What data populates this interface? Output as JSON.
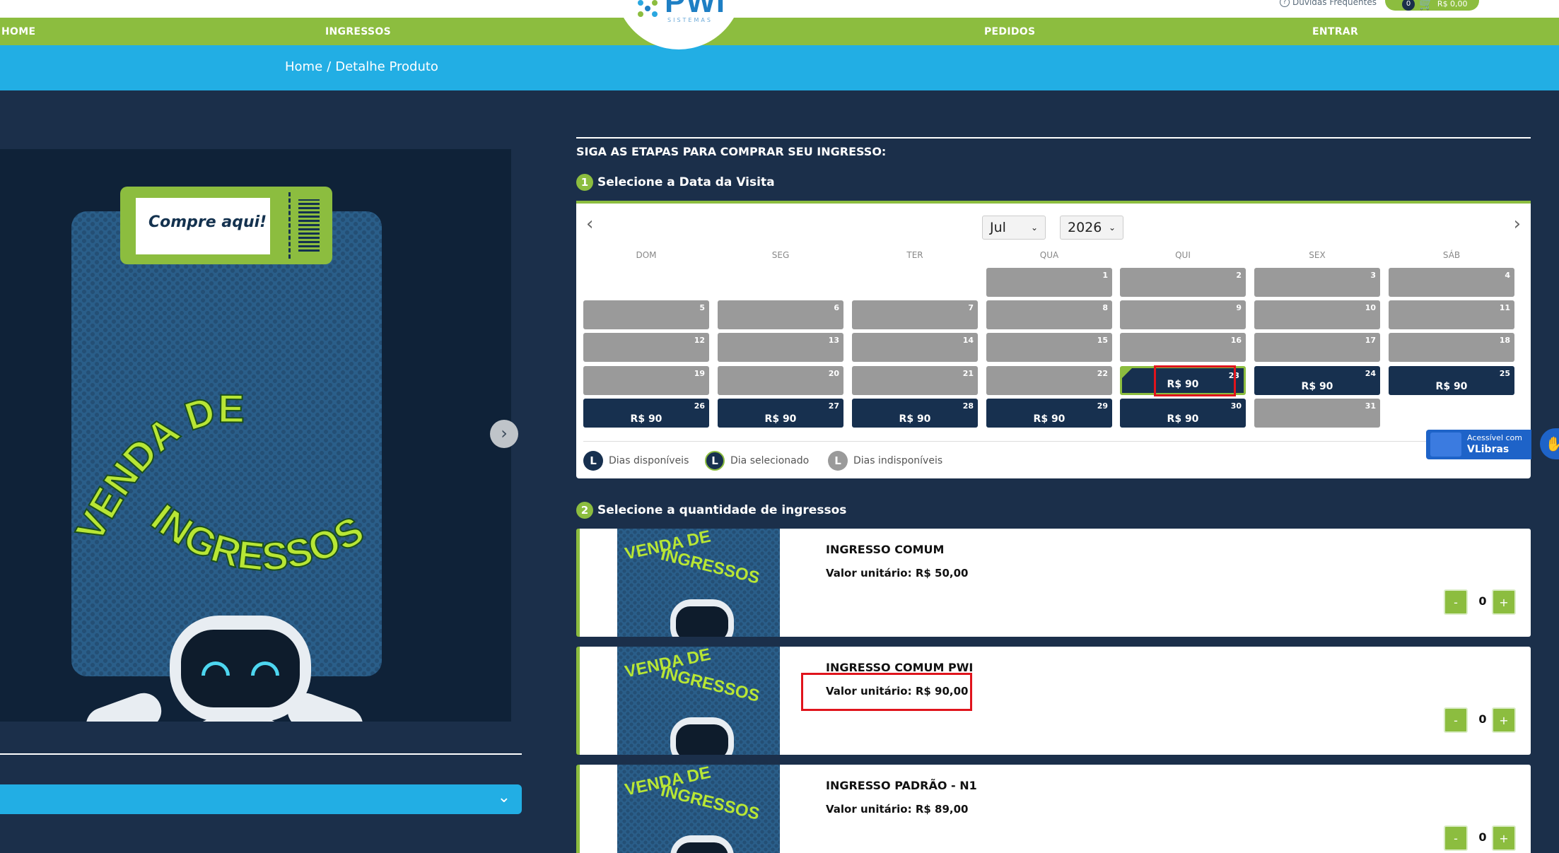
{
  "header": {
    "faq_label": "Dúvidas Frequentes",
    "cart_count": "0",
    "cart_label": "R$ 0,00",
    "logo_text": "PWI",
    "logo_sub": "SISTEMAS",
    "nav": [
      "HOME",
      "INGRESSOS",
      "PEDIDOS",
      "ENTRAR"
    ]
  },
  "breadcrumb": {
    "home": "Home",
    "sep": "/",
    "current": "Detalhe Produto"
  },
  "product_image": {
    "ticket_text": "Compre aqui!",
    "art_line1": "VENDA DE",
    "art_line2": "INGRESSOS"
  },
  "steps": {
    "title": "SIGA AS ETAPAS PARA COMPRAR SEU INGRESSO:",
    "step1_num": "1",
    "step1_label": "Selecione a Data da Visita",
    "step2_num": "2",
    "step2_label": "Selecione a quantidade de ingressos"
  },
  "calendar": {
    "month": "Jul",
    "year": "2026",
    "weekdays": [
      "DOM",
      "SEG",
      "TER",
      "QUA",
      "QUI",
      "SEX",
      "SÁB"
    ],
    "days": [
      {
        "d": "1",
        "state": "unavailable",
        "price": ""
      },
      {
        "d": "2",
        "state": "unavailable",
        "price": ""
      },
      {
        "d": "3",
        "state": "unavailable",
        "price": ""
      },
      {
        "d": "4",
        "state": "unavailable",
        "price": ""
      },
      {
        "d": "5",
        "state": "unavailable",
        "price": ""
      },
      {
        "d": "6",
        "state": "unavailable",
        "price": ""
      },
      {
        "d": "7",
        "state": "unavailable",
        "price": ""
      },
      {
        "d": "8",
        "state": "unavailable",
        "price": ""
      },
      {
        "d": "9",
        "state": "unavailable",
        "price": ""
      },
      {
        "d": "10",
        "state": "unavailable",
        "price": ""
      },
      {
        "d": "11",
        "state": "unavailable",
        "price": ""
      },
      {
        "d": "12",
        "state": "unavailable",
        "price": ""
      },
      {
        "d": "13",
        "state": "unavailable",
        "price": ""
      },
      {
        "d": "14",
        "state": "unavailable",
        "price": ""
      },
      {
        "d": "15",
        "state": "unavailable",
        "price": ""
      },
      {
        "d": "16",
        "state": "unavailable",
        "price": ""
      },
      {
        "d": "17",
        "state": "unavailable",
        "price": ""
      },
      {
        "d": "18",
        "state": "unavailable",
        "price": ""
      },
      {
        "d": "19",
        "state": "unavailable",
        "price": ""
      },
      {
        "d": "20",
        "state": "unavailable",
        "price": ""
      },
      {
        "d": "21",
        "state": "unavailable",
        "price": ""
      },
      {
        "d": "22",
        "state": "unavailable",
        "price": ""
      },
      {
        "d": "23",
        "state": "selected",
        "price": "R$ 90"
      },
      {
        "d": "24",
        "state": "available",
        "price": "R$ 90"
      },
      {
        "d": "25",
        "state": "available",
        "price": "R$ 90"
      },
      {
        "d": "26",
        "state": "available",
        "price": "R$ 90"
      },
      {
        "d": "27",
        "state": "available",
        "price": "R$ 90"
      },
      {
        "d": "28",
        "state": "available",
        "price": "R$ 90"
      },
      {
        "d": "29",
        "state": "available",
        "price": "R$ 90"
      },
      {
        "d": "30",
        "state": "available",
        "price": "R$ 90"
      },
      {
        "d": "31",
        "state": "unavailable",
        "price": ""
      }
    ],
    "legend": [
      {
        "letter": "L",
        "label": "Dias disponíveis",
        "color": "#17304f"
      },
      {
        "letter": "L",
        "label": "Dia selecionado",
        "color": "#17304f"
      },
      {
        "letter": "L",
        "label": "Dias indisponíveis",
        "color": "#9a9a9a"
      }
    ]
  },
  "tickets": [
    {
      "name": "INGRESSO COMUM",
      "price": "Valor unitário: R$ 50,00",
      "qty": "0"
    },
    {
      "name": "INGRESSO COMUM PWI",
      "price": "Valor unitário: R$ 90,00",
      "qty": "0"
    },
    {
      "name": "INGRESSO PADRÃO - N1",
      "price": "Valor unitário: R$ 89,00",
      "qty": "0"
    }
  ],
  "qty_minus": "-",
  "qty_plus": "+",
  "vlibras": {
    "line1": "Acessível com",
    "line2": "VLibras"
  },
  "colors": {
    "green": "#8cbd3f",
    "blue": "#22aee4",
    "navy": "#1b2f4a",
    "highlight": "#e0141c"
  }
}
